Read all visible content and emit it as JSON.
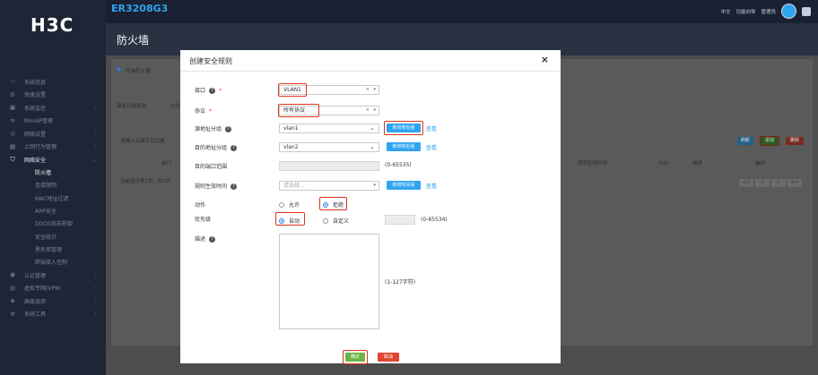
{
  "app": {
    "logo": "H3C",
    "device_name": "ER3208G3",
    "top_links": [
      "中文",
      "功能向导",
      "管理员"
    ]
  },
  "page": {
    "title": "防火墙"
  },
  "sidebar": {
    "items": [
      {
        "label": "系统信息",
        "icon": "wave-icon"
      },
      {
        "label": "快速设置",
        "icon": "gear-icon"
      },
      {
        "label": "系统监控",
        "icon": "monitor-icon"
      },
      {
        "label": "MiniAP管理",
        "icon": "wifi-icon"
      },
      {
        "label": "网络设置",
        "icon": "globe-icon"
      },
      {
        "label": "上网行为管理",
        "icon": "grid-icon"
      },
      {
        "label": "网络安全",
        "icon": "shield-icon"
      }
    ],
    "sub_items": [
      "防火墙",
      "连接限制",
      "MAC地址过滤",
      "ARP安全",
      "DDOS攻击防御",
      "安全统计",
      "黑名单管理",
      "终端接入控制"
    ],
    "bottom_items": [
      {
        "label": "认证管理",
        "icon": "user-icon"
      },
      {
        "label": "虚拟专网(VPN)",
        "icon": "vpn-icon"
      },
      {
        "label": "高级选项",
        "icon": "options-icon"
      },
      {
        "label": "系统工具",
        "icon": "tools-icon"
      }
    ]
  },
  "background": {
    "enable_firewall": "开启防火墙",
    "default_filter": "缺省过滤规则:",
    "default_filter_value": "允许",
    "search_placeholder": "请输入关键字目过滤",
    "table_headers": [
      "接口",
      "规则生效时间",
      "允许",
      "描述",
      "操作"
    ],
    "pager_text": "当前显示第1页，共0页",
    "pager_buttons": [
      "<<",
      "<",
      ">",
      ">>"
    ],
    "btn_refresh": "刷新",
    "btn_add": "添加",
    "btn_delete": "删除"
  },
  "modal": {
    "title": "创建安全规则",
    "close": "×",
    "fields": {
      "interface": {
        "label": "接口",
        "value": "VLAN1"
      },
      "protocol": {
        "label": "协议",
        "value": "所有协议"
      },
      "src_group": {
        "label": "源地址分组",
        "value": "vlan1",
        "btn": "新增地址组",
        "link": "查看"
      },
      "dst_group": {
        "label": "目的地址分组",
        "value": "vlan2",
        "btn": "新增地址组",
        "link": "查看"
      },
      "dst_port": {
        "label": "目的端口范围",
        "hint": "(0-65535)"
      },
      "schedule": {
        "label": "规则生效时间",
        "placeholder": "请选择...",
        "btn": "新增时间段",
        "link": "查看"
      },
      "action": {
        "label": "动作",
        "options": [
          "允许",
          "拒绝"
        ],
        "selected": "拒绝"
      },
      "priority": {
        "label": "优先级",
        "options": [
          "自动",
          "自定义"
        ],
        "selected": "自动",
        "hint": "(0-65534)"
      },
      "description": {
        "label": "描述",
        "hint": "(1-127字符)"
      }
    },
    "ok": "确定",
    "cancel": "取消"
  },
  "colors": {
    "accent": "#2fa4f0",
    "highlight": "#e0321c",
    "ok": "#6bb445",
    "cancel": "#e2452f"
  }
}
